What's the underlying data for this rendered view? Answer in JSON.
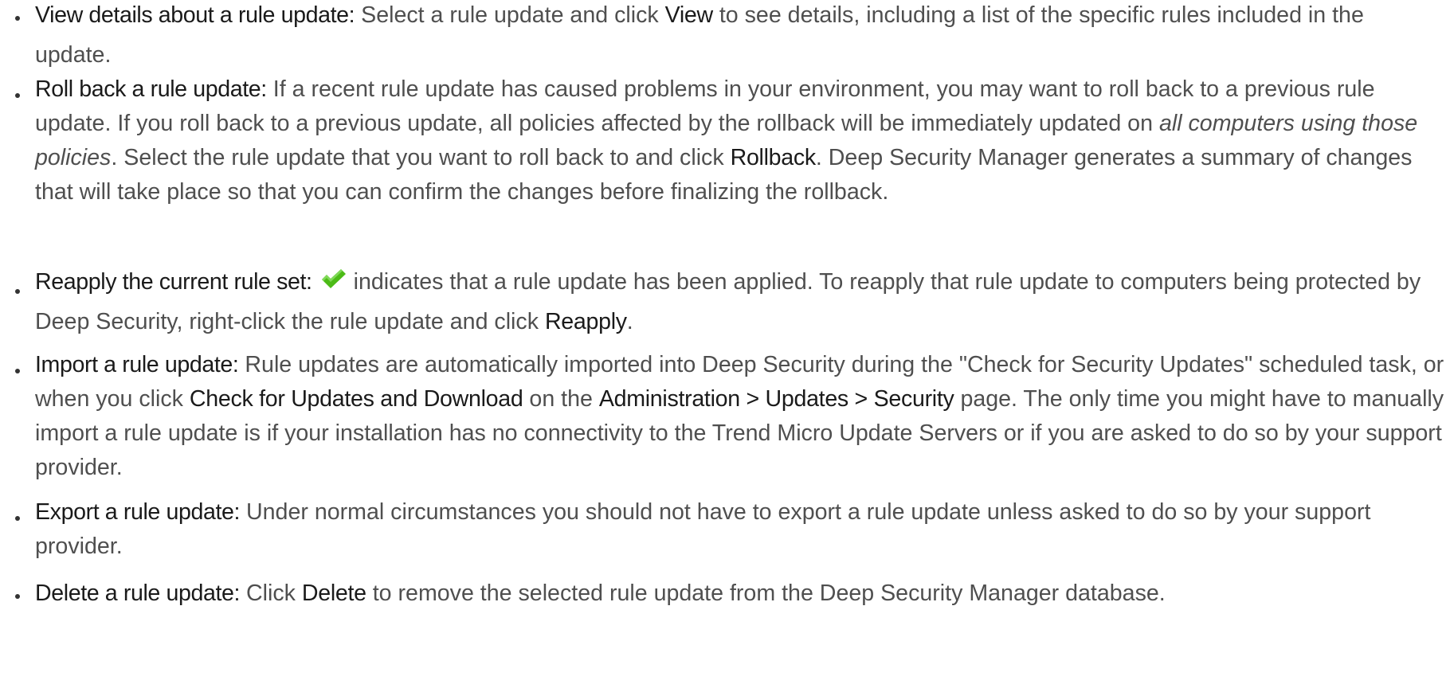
{
  "items": [
    {
      "term": "View details about a rule update:",
      "t1": " Select a rule update and click ",
      "ui1": "View",
      "t2": " to see details, including a list of the specific rules included in the update."
    },
    {
      "term": "Roll back a rule update:",
      "t1": " If a recent rule update has caused problems in your environment, you may want to roll back to a previous rule update. If you roll back to a previous update, all policies affected by the rollback will be immediately updated on ",
      "em1": "all computers using those policies",
      "t2": ". Select the rule update that you want to roll back to and click ",
      "ui1": "Rollback",
      "t3": ". Deep Security Manager generates a summary of changes that will take place so that you can confirm the changes before finalizing the rollback."
    },
    {
      "term": "Reapply the current rule set:",
      "icon": "check-icon",
      "t1": "indicates that a rule update has been applied. To reapply that rule update to computers being protected by Deep Security, right-click the rule update and click ",
      "ui1": "Reapply",
      "t2": "."
    },
    {
      "term": "Import a rule update:",
      "t1": " Rule updates are automatically imported into Deep Security during the \"Check for Security Updates\" scheduled task, or when you click ",
      "ui1": "Check for Updates and Download",
      "t2": " on the ",
      "ui2": "Administration > Updates > Security",
      "t3": " page. The only time you might have to manually import a rule update is if your installation has no connectivity to the Trend Micro Update Servers or if you are asked to do so by your support provider."
    },
    {
      "term": "Export a rule update:",
      "t1": " Under normal circumstances you should not have to export a rule update unless asked to do so by your support provider."
    },
    {
      "term": "Delete a rule update:",
      "t1": " Click ",
      "ui1": "Delete",
      "t2": " to remove the selected rule update from the Deep Security Manager database."
    }
  ],
  "colors": {
    "body_text": "#4f4f4f",
    "term_text": "#1a1a1a",
    "check_icon": "#4cbb17"
  }
}
